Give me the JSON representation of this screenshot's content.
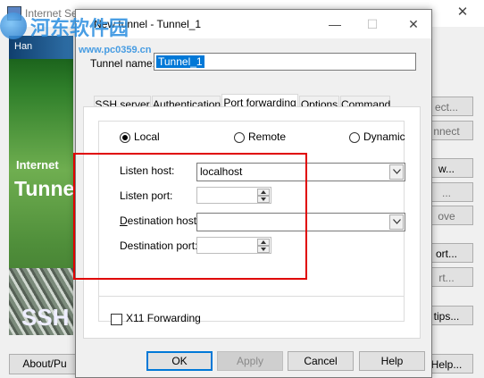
{
  "background_window": {
    "title": "Internet Secure Tunneling",
    "banner": {
      "top_text": "Han",
      "internet_label": "Internet",
      "tunnel_label": "Tunne",
      "ssh_label": "SSH"
    },
    "right_buttons": [
      "ect...",
      "nnect",
      "w...",
      "...",
      "ove",
      "ort...",
      "rt...",
      "tips..."
    ],
    "about_button": "About/Pu",
    "help_button": "Help..."
  },
  "watermark": {
    "text": "河东软件园",
    "url": "www.pc0359.cn"
  },
  "dialog": {
    "title": "New tunnel - Tunnel_1",
    "tunnel_name_label": "Tunnel name:",
    "tunnel_name_value": "Tunnel_1",
    "tabs": [
      "SSH server",
      "Authentication",
      "Port forwarding",
      "Options",
      "Command"
    ],
    "active_tab": "Port forwarding",
    "forwarding": {
      "options": [
        "Local",
        "Remote",
        "Dynamic"
      ],
      "selected": "Local",
      "listen_host_label": "Listen host:",
      "listen_host_value": "localhost",
      "listen_port_label": "Listen port:",
      "listen_port_value": "",
      "destination_host_label": "Destination host:",
      "destination_host_value": "",
      "destination_port_label": "Destination port:",
      "destination_port_value": ""
    },
    "x11_label": "X11 Forwarding",
    "x11_checked": false,
    "buttons": {
      "ok": "OK",
      "apply": "Apply",
      "cancel": "Cancel",
      "help": "Help"
    }
  },
  "colors": {
    "highlight": "#e00000",
    "selection": "#0078d7"
  }
}
